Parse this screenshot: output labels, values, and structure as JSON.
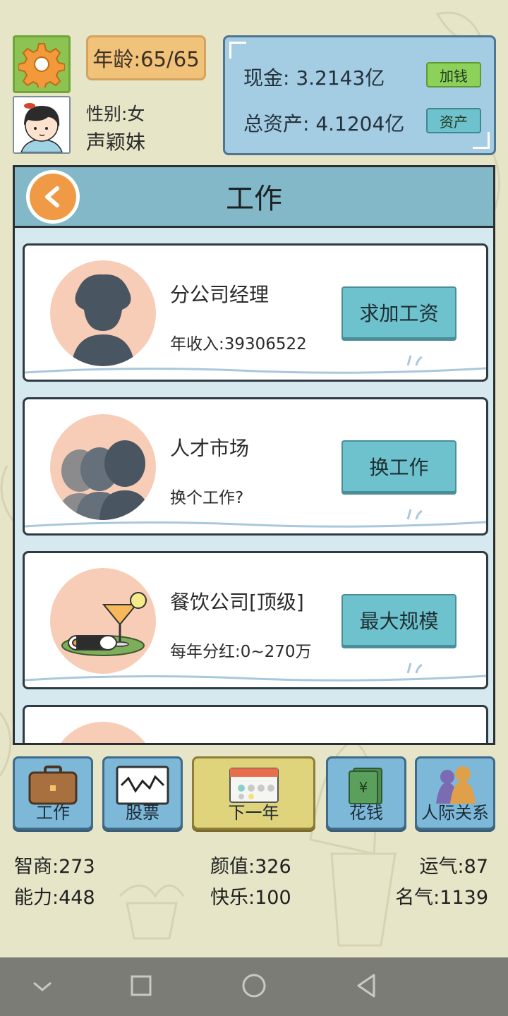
{
  "header": {
    "age_label": "年龄:65/65",
    "gender_label": "性别:女",
    "character_name": "声颖妹"
  },
  "money": {
    "cash_label": "现金: 3.2143亿",
    "add_money_button": "加钱",
    "total_assets_label": "总资产: 4.1204亿",
    "assets_button": "资产"
  },
  "panel": {
    "title": "工作"
  },
  "cards": [
    {
      "title": "分公司经理",
      "subtitle": "年收入:39306522",
      "button": "求加工资",
      "icon": "silhouette-icon"
    },
    {
      "title": "人才市场",
      "subtitle": "换个工作?",
      "button": "换工作",
      "icon": "group-silhouette-icon"
    },
    {
      "title": "餐饮公司[顶级]",
      "subtitle": "每年分红:0~270万",
      "button": "最大规模",
      "icon": "cocktail-sushi-icon"
    }
  ],
  "nav": [
    {
      "label": "工作",
      "icon": "briefcase-icon"
    },
    {
      "label": "股票",
      "icon": "stock-chart-icon"
    },
    {
      "label": "下一年",
      "icon": "calendar-icon"
    },
    {
      "label": "花钱",
      "icon": "money-icon"
    },
    {
      "label": "人际关系",
      "icon": "people-icon"
    }
  ],
  "stats": {
    "iq": "智商:273",
    "looks": "颜值:326",
    "luck": "运气:87",
    "ability": "能力:448",
    "happiness": "快乐:100",
    "fame": "名气:1139"
  },
  "colors": {
    "background": "#e6e5c8",
    "panel_header": "#83b8c8",
    "card_button": "#6ec2cd",
    "nav_button": "#7eb8d8",
    "nav_active": "#dfd37c",
    "add_money_button": "#8cd25a",
    "settings": "#8cc352"
  }
}
